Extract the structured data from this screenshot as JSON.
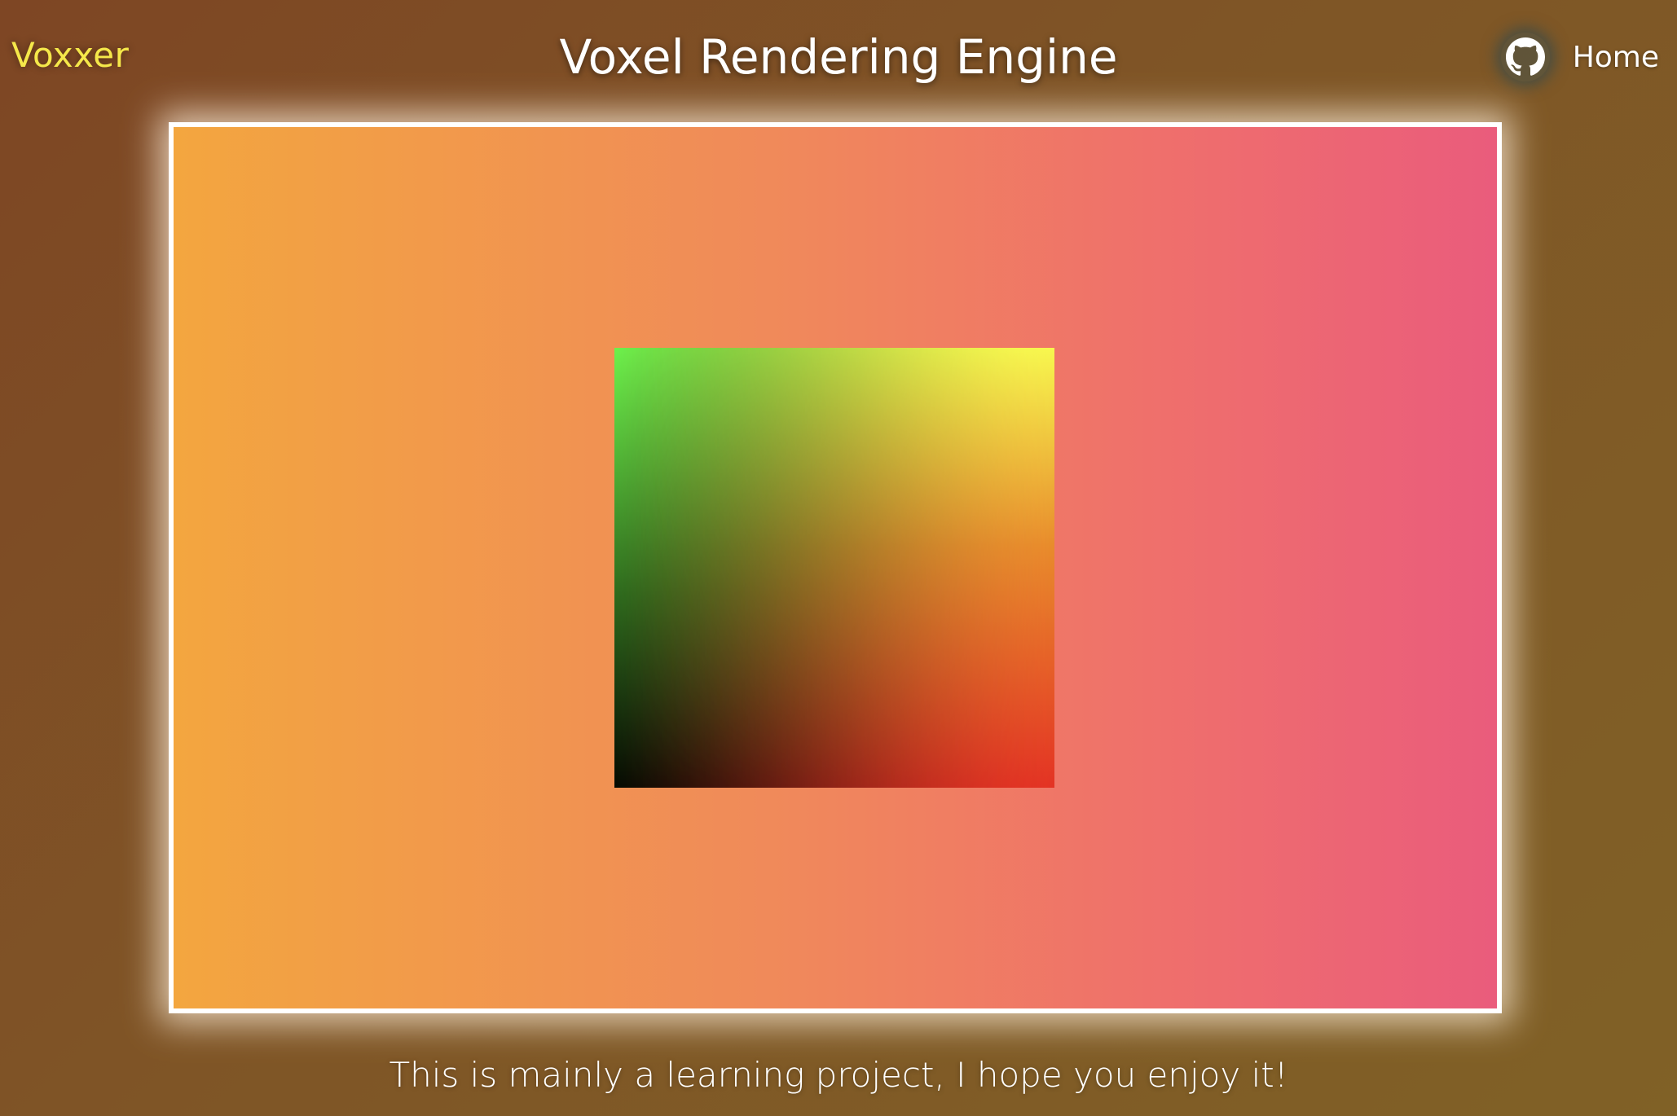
{
  "header": {
    "brand": "Voxxer",
    "title": "Voxel Rendering Engine",
    "nav": {
      "github_icon": "github-icon",
      "home_label": "Home"
    }
  },
  "viewport": {
    "description_icon": "voxel-cube"
  },
  "footer": {
    "tagline": "This is mainly a learning project, I hope you enjoy it!"
  },
  "colors": {
    "brand": "#f5e84a",
    "frame_border": "#ffffff",
    "canvas_left": "#f3a63f",
    "canvas_right": "#ea5c7c",
    "page_bg": "#7f5526"
  }
}
